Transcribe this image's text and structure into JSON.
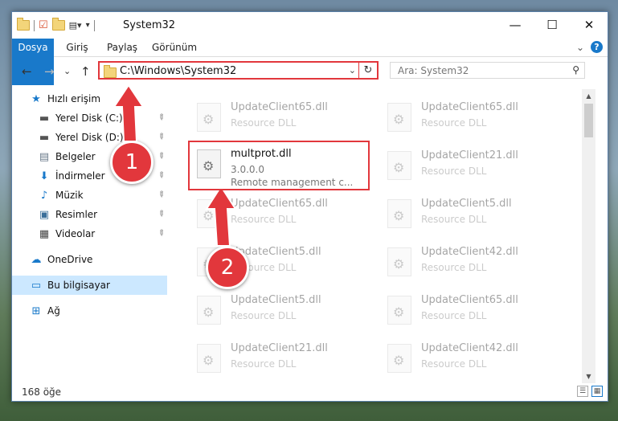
{
  "window": {
    "title": "System32",
    "minimize": "—",
    "maximize": "☐",
    "close": "✕"
  },
  "ribbon": {
    "tabs": [
      "Dosya",
      "Giriş",
      "Paylaş",
      "Görünüm"
    ],
    "expand": "⌄",
    "help": "?"
  },
  "nav": {
    "back": "←",
    "forward": "→",
    "recent": "⌄",
    "up": "↑"
  },
  "address": {
    "path": "C:\\Windows\\System32",
    "dropdown": "⌄",
    "refresh": "↻"
  },
  "search": {
    "placeholder": "Ara: System32",
    "icon": "search-icon"
  },
  "sidebar": {
    "items": [
      {
        "label": "Hızlı erişim",
        "icon": "star-icon",
        "glyph": "★",
        "color": "#1979ca",
        "pinned": false
      },
      {
        "label": "Yerel Disk (C:)",
        "icon": "drive-icon",
        "glyph": "▬",
        "color": "#555555",
        "pinned": true
      },
      {
        "label": "Yerel Disk (D:)",
        "icon": "drive-icon",
        "glyph": "▬",
        "color": "#555555",
        "pinned": true
      },
      {
        "label": "Belgeler",
        "icon": "documents-icon",
        "glyph": "▤",
        "color": "#6a7a8a",
        "pinned": true
      },
      {
        "label": "İndirmeler",
        "icon": "download-icon",
        "glyph": "⬇",
        "color": "#1979ca",
        "pinned": true
      },
      {
        "label": "Müzik",
        "icon": "music-icon",
        "glyph": "♪",
        "color": "#1979ca",
        "pinned": true
      },
      {
        "label": "Resimler",
        "icon": "pictures-icon",
        "glyph": "▣",
        "color": "#3a6f9a",
        "pinned": true
      },
      {
        "label": "Videolar",
        "icon": "videos-icon",
        "glyph": "▦",
        "color": "#444444",
        "pinned": true
      },
      {
        "label": "OneDrive",
        "icon": "cloud-icon",
        "glyph": "☁",
        "color": "#1979ca",
        "pinned": false
      },
      {
        "label": "Bu bilgisayar",
        "icon": "computer-icon",
        "glyph": "▭",
        "color": "#1979ca",
        "pinned": false,
        "selected": true
      },
      {
        "label": "Ağ",
        "icon": "network-icon",
        "glyph": "⊞",
        "color": "#1979ca",
        "pinned": false
      }
    ],
    "pin_glyph": "📌"
  },
  "files": {
    "left_column": [
      {
        "name": "UpdateClient65.dll",
        "desc": "Resource DLL",
        "ghost": true
      },
      {
        "name": "multprot.dll",
        "version": "3.0.0.0",
        "desc": "Remote management c...",
        "highlight": true
      },
      {
        "name": "UpdateClient65.dll",
        "desc": "Resource DLL",
        "ghost": true
      },
      {
        "name": "UpdateClient5.dll",
        "desc": "Resource DLL",
        "ghost": true
      },
      {
        "name": "UpdateClient5.dll",
        "desc": "Resource DLL",
        "ghost": true
      },
      {
        "name": "UpdateClient21.dll",
        "desc": "Resource DLL",
        "ghost": true
      }
    ],
    "right_column": [
      {
        "name": "UpdateClient65.dll",
        "desc": "Resource DLL"
      },
      {
        "name": "UpdateClient21.dll",
        "desc": "Resource DLL"
      },
      {
        "name": "UpdateClient5.dll",
        "desc": "Resource DLL"
      },
      {
        "name": "UpdateClient42.dll",
        "desc": "Resource DLL"
      },
      {
        "name": "UpdateClient65.dll",
        "desc": "Resource DLL"
      },
      {
        "name": "UpdateClient42.dll",
        "desc": "Resource DLL"
      }
    ]
  },
  "status": {
    "count": "168 öğe"
  },
  "callouts": [
    "1",
    "2"
  ],
  "colors": {
    "accent": "#1979ca",
    "highlight": "#e2373c"
  }
}
